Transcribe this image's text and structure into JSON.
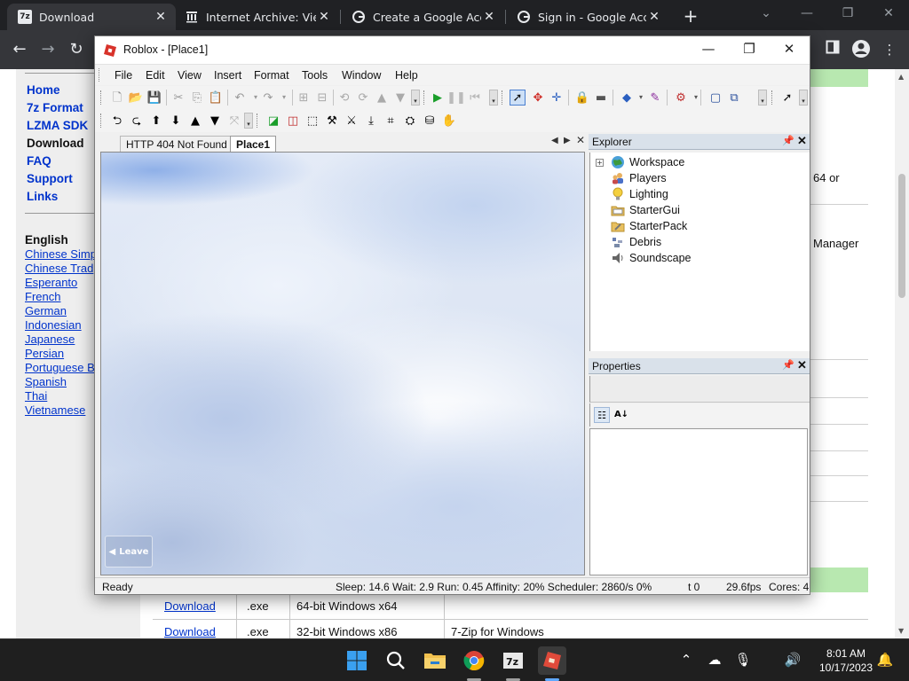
{
  "browser": {
    "tabs": [
      {
        "title": "Download",
        "favicon": "7z"
      },
      {
        "title": "Internet Archive: View",
        "favicon": "archive"
      },
      {
        "title": "Create a Google Acco",
        "favicon": "G"
      },
      {
        "title": "Sign in - Google Acco",
        "favicon": "G"
      }
    ],
    "new_tab_symbol": "+"
  },
  "website": {
    "menu": [
      "Home",
      "7z Format",
      "LZMA SDK",
      "Download",
      "FAQ",
      "Support",
      "Links"
    ],
    "lang_heading": "English",
    "languages": [
      "Chinese Simp",
      "Chinese Trad",
      "Esperanto",
      "French",
      "German",
      "Indonesian",
      "Japanese",
      "Persian",
      "Portuguese B",
      "Spanish",
      "Thai",
      "Vietnamese"
    ],
    "right_text_1": "64 or",
    "right_text_2": "Manager",
    "table_rows": [
      {
        "link": "Download",
        "type": ".exe",
        "desc": "64-bit Windows x64",
        "extra": ""
      },
      {
        "link": "Download",
        "type": ".exe",
        "desc": "32-bit Windows x86",
        "extra": "7-Zip for Windows"
      }
    ]
  },
  "roblox": {
    "window_title": "Roblox - [Place1]",
    "menu": [
      "File",
      "Edit",
      "View",
      "Insert",
      "Format",
      "Tools",
      "Window",
      "Help"
    ],
    "doc_tabs": [
      "HTTP 404 Not Found",
      "Place1"
    ],
    "leave_label": "Leave",
    "explorer": {
      "title": "Explorer",
      "items": [
        {
          "label": "Workspace",
          "icon": "globe-icon"
        },
        {
          "label": "Players",
          "icon": "players-icon"
        },
        {
          "label": "Lighting",
          "icon": "bulb-icon"
        },
        {
          "label": "StarterGui",
          "icon": "folder-icon"
        },
        {
          "label": "StarterPack",
          "icon": "pack-icon"
        },
        {
          "label": "Debris",
          "icon": "debris-icon"
        },
        {
          "label": "Soundscape",
          "icon": "speaker-icon"
        }
      ]
    },
    "properties": {
      "title": "Properties"
    },
    "status": {
      "ready": "Ready",
      "perf": "Sleep: 14.6 Wait: 2.9 Run: 0.45 Affinity: 20% Scheduler: 2860/s 0%",
      "time": "t 0",
      "fps": "29.6fps",
      "cores": "Cores: 4"
    }
  },
  "taskbar": {
    "time": "8:01 AM",
    "date": "10/17/2023"
  },
  "colors": {
    "chrome_dark": "#202124",
    "link_blue": "#0033cc",
    "green_header": "#b8e8b0",
    "play_green": "#1a9e2a"
  }
}
